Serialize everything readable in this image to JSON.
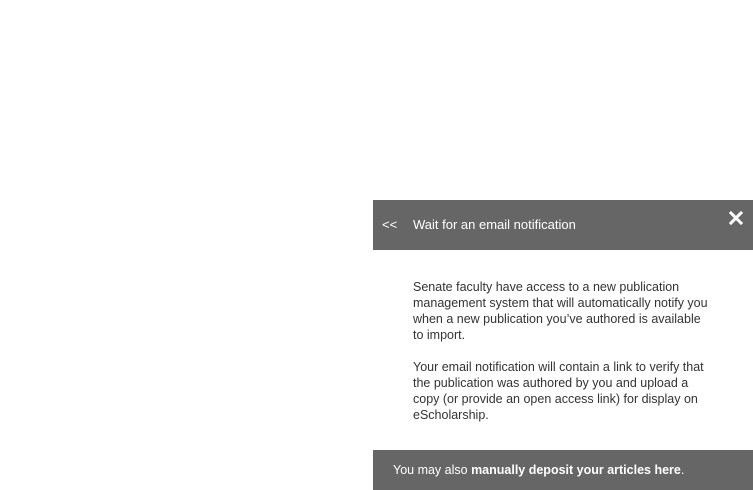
{
  "panel": {
    "back_label": "<<",
    "title": "Wait for an email notification",
    "close_icon": "close-x-icon",
    "paragraphs": [
      "Senate faculty have access to a new publication management system that will automatically notify you when a new publication you’ve authored is available to import.",
      "Your email notification will contain a link to verify that the publication was authored by you and upload a copy (or provide an open access link) for display on eScholarship."
    ],
    "footer": {
      "prefix": "You may also ",
      "link_text": "manually deposit your articles here",
      "suffix": "."
    }
  },
  "colors": {
    "header_bg": "#666666",
    "footer_bg": "#666666",
    "body_text": "#333333",
    "header_text": "#ffffff"
  }
}
